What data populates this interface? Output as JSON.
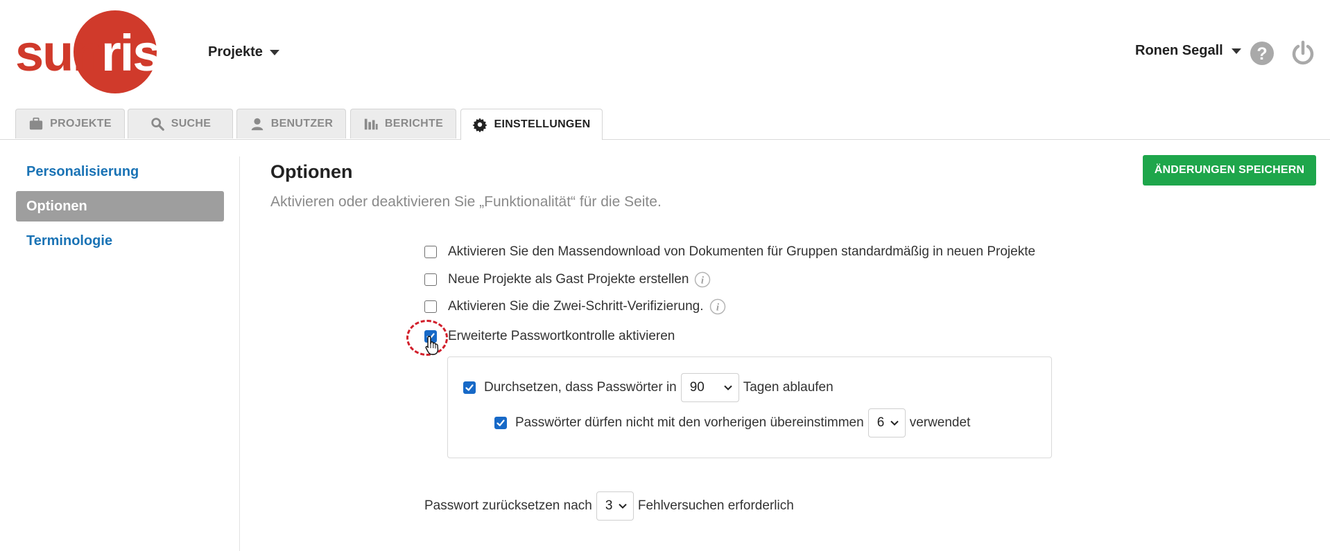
{
  "brand": {
    "logo_text": "sunrise",
    "logo_color": "#d03a2b"
  },
  "header": {
    "projects_label": "Projekte",
    "user_name": "Ronen Segall",
    "help_icon": "question-circle-icon",
    "power_icon": "power-icon"
  },
  "tabs": [
    {
      "label": "PROJEKTE",
      "icon": "briefcase-icon"
    },
    {
      "label": "SUCHE",
      "icon": "search-icon"
    },
    {
      "label": "BENUTZER",
      "icon": "user-icon"
    },
    {
      "label": "BERICHTE",
      "icon": "bar-chart-icon"
    },
    {
      "label": "EINSTELLUNGEN",
      "icon": "gear-icon",
      "active": true
    }
  ],
  "sidebar": {
    "items": [
      {
        "label": "Personalisierung"
      },
      {
        "label": "Optionen",
        "active": true
      },
      {
        "label": "Terminologie"
      }
    ]
  },
  "main": {
    "title": "Optionen",
    "subtitle": "Aktivieren oder deaktivieren Sie „Funktionalität“ für die Seite.",
    "save_label": "ÄNDERUNGEN SPEICHERN",
    "options": {
      "bulk_download": {
        "label": "Aktivieren Sie den Massendownload von Dokumenten für Gruppen standardmäßig in neuen Projekte",
        "checked": false
      },
      "guest_projects": {
        "label": "Neue Projekte als Gast Projekte erstellen",
        "checked": false
      },
      "two_step": {
        "label": "Aktivieren Sie die Zwei-Schritt-Verifizierung.",
        "checked": false
      },
      "password_control": {
        "label": "Erweiterte Passwortkontrolle aktivieren",
        "checked": true
      }
    },
    "password": {
      "expire_prefix": "Durchsetzen, dass Passwörter in",
      "expire_value": "90",
      "expire_suffix": "Tagen ablaufen",
      "expire_checked": true,
      "history_prefix": "Passwörter dürfen nicht mit den vorherigen übereinstimmen",
      "history_value": "6",
      "history_suffix": "verwendet",
      "history_checked": true
    },
    "reset": {
      "prefix": "Passwort zurücksetzen nach",
      "value": "3",
      "suffix": "Fehlversuchen erforderlich"
    }
  },
  "colors": {
    "accent_link": "#1a73b5",
    "save_button": "#1ea64b",
    "checkbox_checked": "#1769c7",
    "highlight_ring": "#d21f2b"
  }
}
